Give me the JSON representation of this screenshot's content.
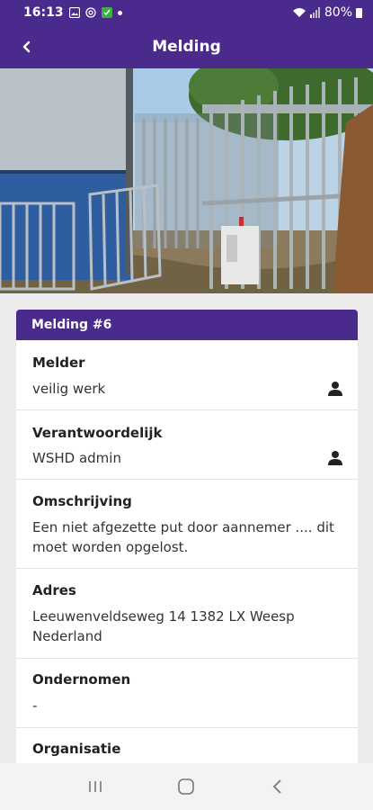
{
  "status_bar": {
    "time": "16:13",
    "battery": "80%"
  },
  "app_bar": {
    "title": "Melding"
  },
  "card": {
    "title": "Melding #6",
    "fields": [
      {
        "label": "Melder",
        "value": "veilig werk",
        "icon": "person-icon"
      },
      {
        "label": "Verantwoordelijk",
        "value": "WSHD admin",
        "icon": "person-icon"
      },
      {
        "label": "Omschrijving",
        "value_lines": [
          "Een niet afgezette put door aannemer .... dit",
          "moet worden opgelost."
        ]
      },
      {
        "label": "Adres",
        "value_lines": [
          "Leeuwenveldseweg 14 1382 LX Weesp",
          "Nederland"
        ]
      },
      {
        "label": "Ondernomen",
        "value": "-"
      },
      {
        "label": "Organisatie"
      }
    ]
  },
  "colors": {
    "primary": "#4a2a8c",
    "background": "#ececec"
  }
}
